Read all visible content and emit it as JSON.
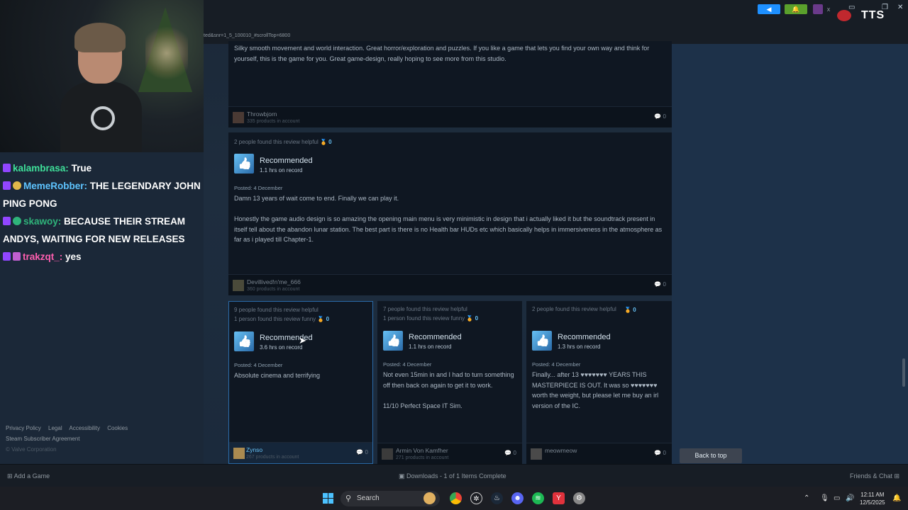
{
  "browser": {
    "url_fragment": "ted&snr=1_5_100010_#scrollTop=6800"
  },
  "overlay": {
    "tts_label": "TTS"
  },
  "chat": {
    "lines": [
      {
        "user": "kalambrasa:",
        "user_color": "#3fe09a",
        "message": "True"
      },
      {
        "user": "MemeRobber:",
        "user_color": "#5ec4ff",
        "message": "THE LEGENDARY JOHN PING PONG"
      },
      {
        "user": "skawoy:",
        "user_color": "#2fb37a",
        "message": "BECAUSE THEIR STREAM ANDYS, WAITING FOR NEW RELEASES"
      },
      {
        "user": "trakzqt_:",
        "user_color": "#ff5fb0",
        "message": "yes"
      }
    ]
  },
  "footer": {
    "links": [
      "Privacy Policy",
      "Legal",
      "Accessibility",
      "Cookies"
    ],
    "agreement": "Steam Subscriber Agreement",
    "copyright": "© Valve Corporation"
  },
  "reviews": {
    "top": {
      "body": "Silky smooth movement and world interaction. Great horror/exploration and puzzles. If you like a game that lets you find your own way and think for yourself, this is the game for you. Great game-design, really hoping to see more from this studio.",
      "user": "Throwbjorn",
      "products": "335 products in account",
      "comments": "0"
    },
    "mid": {
      "helpful": "2 people found this review helpful",
      "awards": "0",
      "verdict": "Recommended",
      "hours": "1.1 hrs on record",
      "posted": "Posted: 4 December",
      "body1": "Damn 13 years of wait come to end. Finally we can play it.",
      "body2": "Honestly the game audio design is so amazing the opening main menu is very minimistic in design that i actually liked it but the soundtrack present in itself tell about the abandon lunar station. The best part is there is no Health bar HUDs etc which basically helps in immersiveness in the atmosphere as far as i played till Chapter-1.",
      "user": "Devillived!n'me_666",
      "products": "360 products in account",
      "comments": "0"
    },
    "cards": [
      {
        "helpful": "9 people found this review helpful",
        "funny": "1 person found this review funny",
        "awards": "0",
        "verdict": "Recommended",
        "hours": "3.6 hrs on record",
        "posted": "Posted: 4 December",
        "body": "Absolute cinema and terrifying",
        "user": "Zynso",
        "products": "267 products in account",
        "comments": "0"
      },
      {
        "helpful": "7 people found this review helpful",
        "funny": "1 person found this review funny",
        "awards": "0",
        "verdict": "Recommended",
        "hours": "1.1 hrs on record",
        "posted": "Posted: 4 December",
        "body": "Not even 15min in and I had to turn something off then back on again to get it to work.\n\n11/10 Perfect Space IT Sim.",
        "user": "Armin Von Kamfher",
        "products": "271 products in account",
        "comments": "0"
      },
      {
        "helpful": "2 people found this review helpful",
        "funny": "",
        "awards": "0",
        "verdict": "Recommended",
        "hours": "1.3 hrs on record",
        "posted": "Posted: 4 December",
        "body": "Finally... after 13 ♥♥♥♥♥♥♥ YEARS THIS MASTERPIECE IS OUT. It was so ♥♥♥♥♥♥♥ worth the weight, but please let me buy an irl version of the IC.",
        "user": "meowmeow",
        "products": "",
        "comments": "0"
      }
    ],
    "back_to_top": "Back to top"
  },
  "steam_bar": {
    "add_game": "Add a Game",
    "downloads": "Downloads - 1 of 1 Items Complete",
    "friends": "Friends & Chat"
  },
  "taskbar": {
    "search": "Search",
    "time": "12:11 AM",
    "date": "12/5/2025"
  }
}
